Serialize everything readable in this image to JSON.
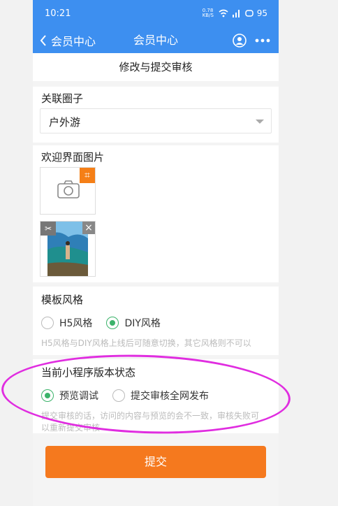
{
  "status_bar": {
    "time": "10:21",
    "speed": "0.78 KB/S",
    "battery": "95"
  },
  "nav": {
    "back_label": "会员中心",
    "title": "会员中心"
  },
  "page_subtitle": "修改与提交审核",
  "circle": {
    "label": "关联圈子",
    "selected": "户外游"
  },
  "welcome": {
    "label": "欢迎界面图片"
  },
  "template": {
    "label": "模板风格",
    "options": [
      "H5风格",
      "DIY风格"
    ],
    "selected": "DIY风格",
    "hint": "H5风格与DIY风格上线后可随意切换，其它风格则不可以"
  },
  "version_status": {
    "label": "当前小程序版本状态",
    "options": [
      "预览调试",
      "提交审核全网发布"
    ],
    "selected": "预览调试",
    "hint_line1": "提交审核的话，访问的内容与预览的会不一致，审核失败可",
    "hint_line2": "以重新提交审核"
  },
  "submit_label": "提交",
  "colors": {
    "primary": "#3d8ff0",
    "accent": "#f5791e",
    "selected": "#3bb36a",
    "annotation": "#e02de0"
  },
  "icons": [
    "chevron-left-icon",
    "user-icon",
    "more-icon",
    "camera-icon",
    "crop-icon",
    "scissors-icon",
    "close-icon",
    "wifi-icon",
    "signal-icon",
    "battery-icon"
  ]
}
